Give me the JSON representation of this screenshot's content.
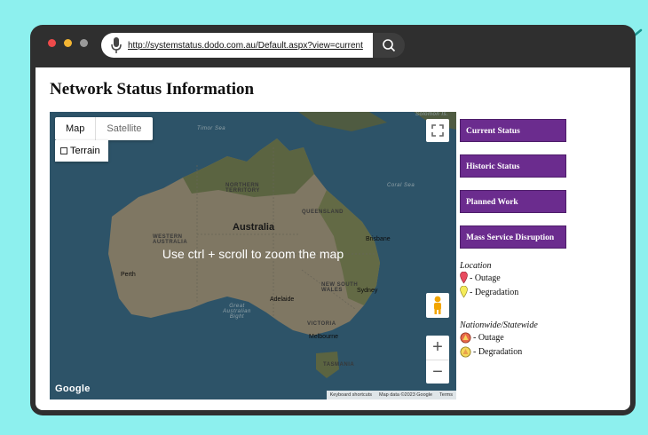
{
  "browser": {
    "url": "http://systemstatus.dodo.com.au/Default.aspx?view=current"
  },
  "page": {
    "title": "Network Status Information"
  },
  "map": {
    "map_type_options": [
      "Map",
      "Satellite"
    ],
    "terrain_label": "Terrain",
    "zoom_hint": "Use ctrl + scroll to zoom the map",
    "country_label": "Australia",
    "region_labels": {
      "nt": "NORTHERN TERRITORY",
      "wa": "WESTERN AUSTRALIA",
      "qld": "QUEENSLAND",
      "nsw": "NEW SOUTH WALES",
      "vic": "VICTORIA",
      "tas": "TASMANIA"
    },
    "city_labels": {
      "perth": "Perth",
      "brisbane": "Brisbane",
      "sydney": "Sydney",
      "adelaide": "Adelaide",
      "melbourne": "Melbourne"
    },
    "sea_labels": {
      "timor": "Timor Sea",
      "coral": "Coral Sea",
      "bight": "Great Australian Bight",
      "solomon": "Solomon Is."
    },
    "brand": "Google",
    "attribution": [
      "Keyboard shortcuts",
      "Map data ©2023 Google",
      "Terms"
    ],
    "zoom_in": "+",
    "zoom_out": "−"
  },
  "sidebar": {
    "buttons": [
      "Current Status",
      "Historic Status",
      "Planned Work",
      "Mass Service Disruption"
    ],
    "legend": {
      "location_heading": "Location",
      "location_items": [
        "- Outage",
        "- Degradation"
      ],
      "nationwide_heading": "Nationwide/Statewide",
      "nationwide_items": [
        "- Outage",
        "- Degradation"
      ]
    }
  },
  "colors": {
    "background": "#8df0ee",
    "frame": "#2f2f2f",
    "button_purple": "#6b2c8e",
    "arrow_teal": "#17948f"
  }
}
